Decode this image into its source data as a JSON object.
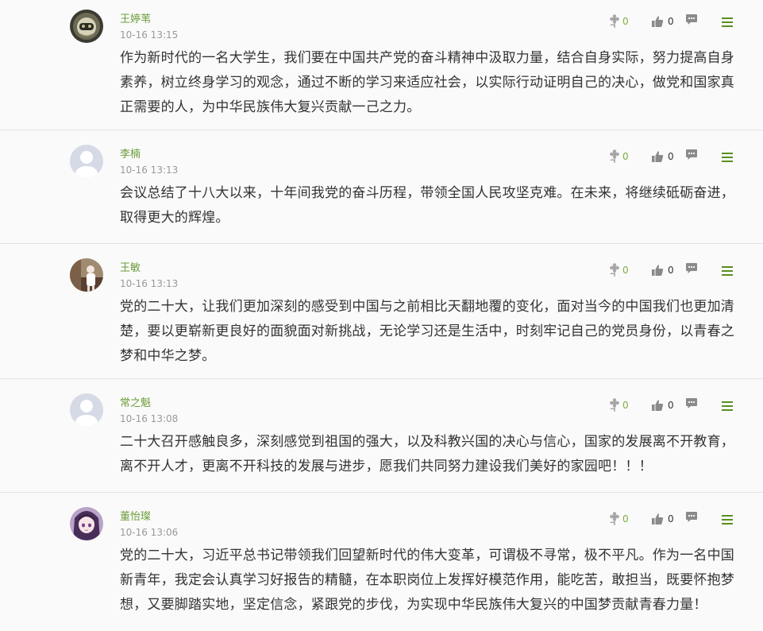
{
  "comments": [
    {
      "name": "王婷苇",
      "time": "10-16 13:15",
      "text": "作为新时代的一名大学生，我们要在中国共产党的奋斗精神中汲取力量，结合自身实际，努力提高自身素养，树立终身学习的观念，通过不断的学习来适应社会，以实际行动证明自己的决心，做党和国家真正需要的人，为中华民族伟大复兴贡献一己之力。",
      "flower_count": "0",
      "like_count": "0",
      "avatar": "photo-avatar-astronaut"
    },
    {
      "name": "李楠",
      "time": "10-16 13:13",
      "text": "会议总结了十八大以来，十年间我党的奋斗历程，带领全国人民攻坚克难。在未来，将继续砥砺奋进，取得更大的辉煌。",
      "flower_count": "0",
      "like_count": "0",
      "avatar": "default-avatar"
    },
    {
      "name": "王敏",
      "time": "10-16 13:13",
      "text": "党的二十大，让我们更加深刻的感受到中国与之前相比天翻地覆的变化，面对当今的中国我们也更加清楚，要以更崭新更良好的面貌面对新挑战，无论学习还是生活中，时刻牢记自己的党员身份，以青春之梦和中华之梦。",
      "flower_count": "0",
      "like_count": "0",
      "avatar": "photo-avatar-person"
    },
    {
      "name": "常之魁",
      "time": "10-16 13:08",
      "text": "二十大召开感触良多，深刻感觉到祖国的强大，以及科教兴国的决心与信心，国家的发展离不开教育，离不开人才，更离不开科技的发展与进步，愿我们共同努力建设我们美好的家园吧！！！",
      "flower_count": "0",
      "like_count": "0",
      "avatar": "default-avatar"
    },
    {
      "name": "董怡璨",
      "time": "10-16 13:06",
      "text": "党的二十大，习近平总书记带领我们回望新时代的伟大变革，可谓极不寻常，极不平凡。作为一名中国新青年，我定会认真学习好报告的精髓，在本职岗位上发挥好模范作用，能吃苦，敢担当，既要怀抱梦想，又要脚踏实地，坚定信念，紧跟党的步伐，为实现中华民族伟大复兴的中国梦贡献青春力量！",
      "flower_count": "0",
      "like_count": "0",
      "avatar": "anime-avatar"
    }
  ],
  "colors": {
    "name": "#6c9c3a",
    "flower_count": "#7ab040",
    "menu_icon": "#5a8f1e",
    "text": "#333333",
    "time": "#9a9a9a"
  }
}
